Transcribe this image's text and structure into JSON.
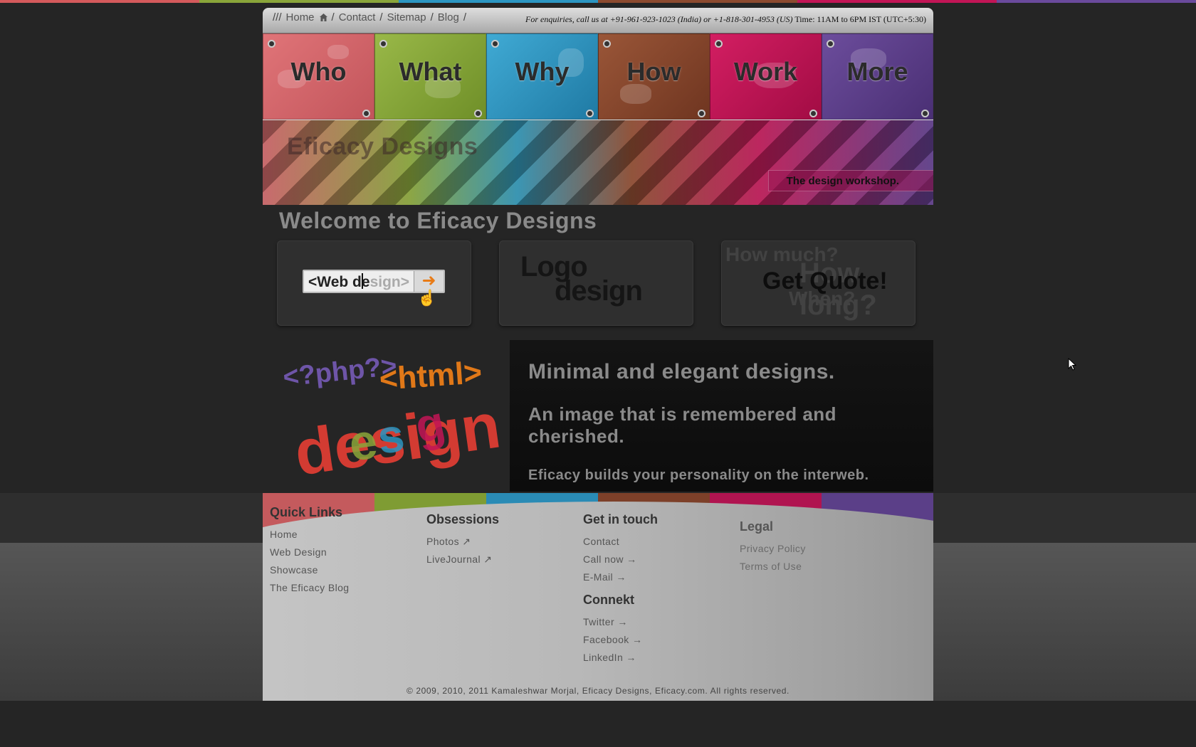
{
  "colors": {
    "red": "#d45a5c",
    "green": "#8aa53a",
    "blue": "#2b95c1",
    "brown": "#8c4a2f",
    "magenta": "#c21556",
    "purple": "#6a4a9c",
    "background": "#252525"
  },
  "topbar": {
    "lead": "///",
    "links": [
      "Home",
      "Contact",
      "Sitemap",
      "Blog"
    ],
    "separator": "/",
    "enquiry_text": "For enquiries, call us at +91-961-923-1023 (India) or +1-818-301-4953 (US)",
    "enquiry_time": "Time: 11AM to 6PM IST (UTC+5:30)"
  },
  "nav": [
    {
      "label": "Who",
      "color": "#d36469"
    },
    {
      "label": "What",
      "color": "#86a437"
    },
    {
      "label": "Why",
      "color": "#2f98c4"
    },
    {
      "label": "How",
      "color": "#87472d"
    },
    {
      "label": "Work",
      "color": "#bf1554"
    },
    {
      "label": "More",
      "color": "#5e3f8c"
    }
  ],
  "banner": {
    "brand": "Eficacy Designs",
    "tagline": "The design workshop."
  },
  "welcome": "Welcome to Eficacy Designs",
  "services": {
    "web_design_typed": "<Web de",
    "web_design_rest": "sign>",
    "logo_line1": "Logo",
    "logo_line2": "design",
    "quote_ghost_1": "How much?",
    "quote_ghost_2": "How long?",
    "quote_ghost_3": "When?",
    "quote_label": "Get Quote!"
  },
  "feature": {
    "art_php": "<?php?>",
    "art_html": "<html>",
    "art_design": "design",
    "line1": "Minimal and elegant designs.",
    "line2": "An image that is remembered and cherished.",
    "line3": "Eficacy builds your personality on the interweb."
  },
  "footer": {
    "quick_links": {
      "title": "Quick Links",
      "items": [
        "Home",
        "Web Design",
        "Showcase",
        "The Eficacy Blog"
      ]
    },
    "obsessions": {
      "title": "Obsessions",
      "items": [
        "Photos ↗",
        "LiveJournal ↗"
      ]
    },
    "get_in_touch": {
      "title": "Get in touch",
      "items": [
        "Contact",
        "Call now →",
        "E-Mail →"
      ]
    },
    "connekt": {
      "title": "Connekt",
      "items": [
        "Twitter →",
        "Facebook →",
        "LinkedIn →"
      ]
    },
    "legal": {
      "title": "Legal",
      "items": [
        "Privacy Policy",
        "Terms of Use"
      ]
    },
    "copyright": "© 2009, 2010, 2011 Kamaleshwar Morjal, Eficacy Designs, Eficacy.com. All rights reserved."
  }
}
